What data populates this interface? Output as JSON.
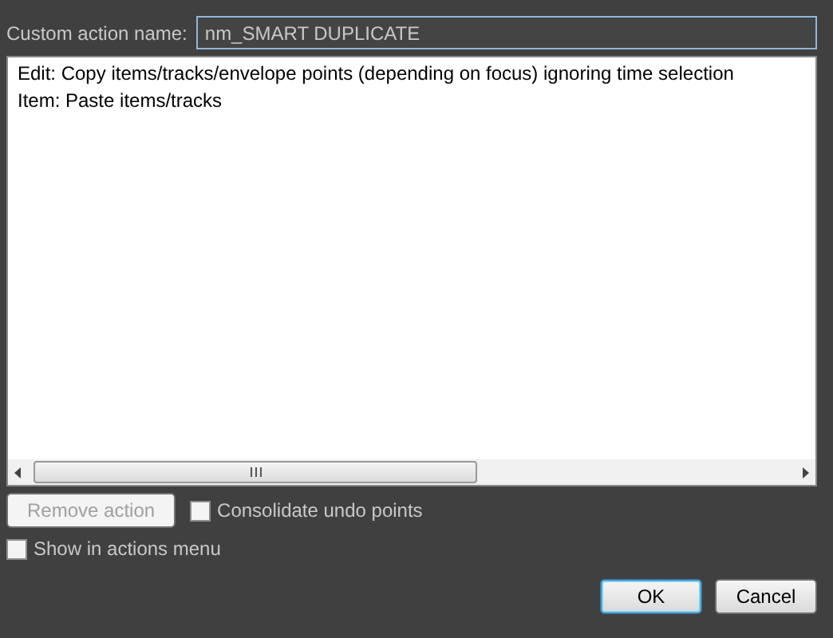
{
  "name_field": {
    "label": "Custom action name:",
    "value": "nm_SMART DUPLICATE",
    "focused": true
  },
  "actions": [
    {
      "text": "Edit: Copy items/tracks/envelope points (depending on focus) ignoring time selection",
      "selected": false
    },
    {
      "text": "Item: Paste items/tracks",
      "selected": false
    }
  ],
  "remove_button": {
    "label": "Remove action",
    "disabled": true
  },
  "consolidate": {
    "label": "Consolidate undo points",
    "checked": false
  },
  "show_in_menu": {
    "label": "Show in actions menu",
    "checked": false
  },
  "buttons": [
    {
      "label": "OK",
      "kind": "default"
    },
    {
      "label": "Cancel",
      "kind": "normal"
    }
  ]
}
